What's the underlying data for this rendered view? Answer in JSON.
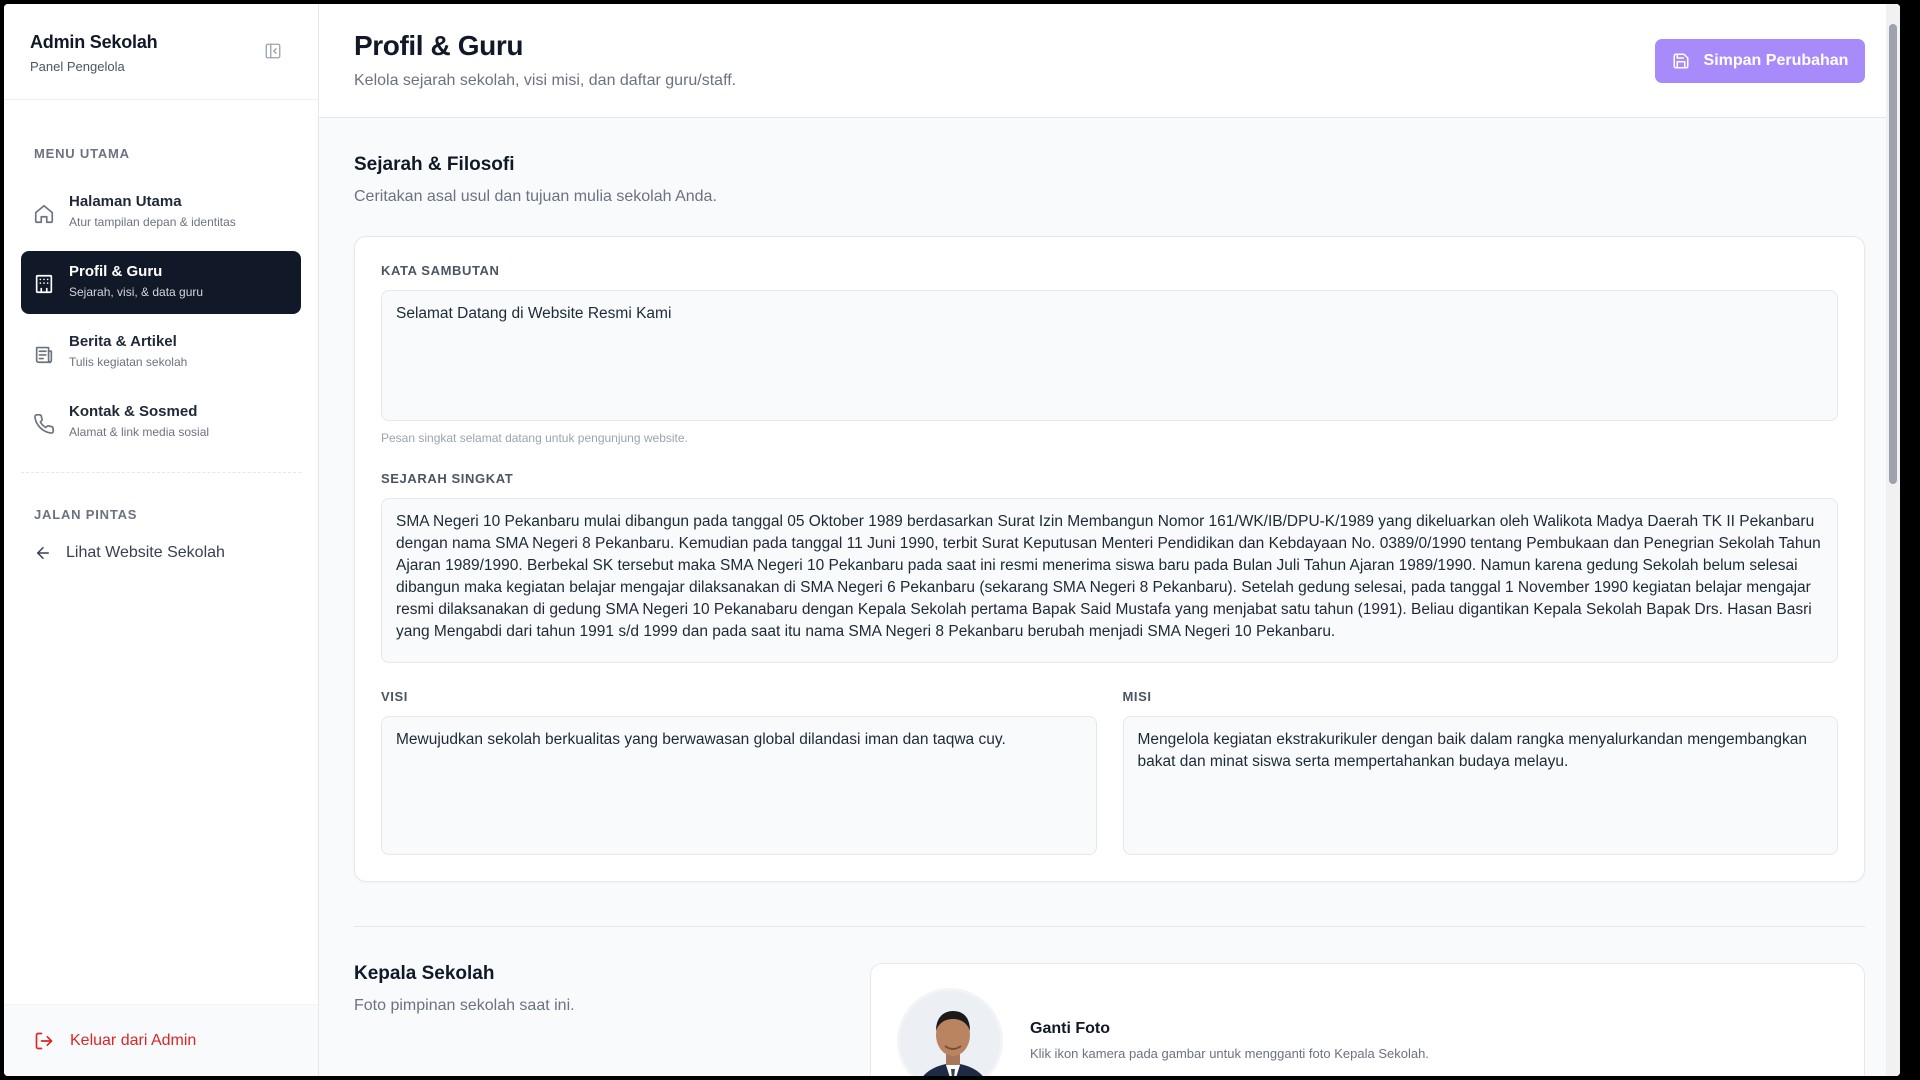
{
  "sidebar": {
    "brand_title": "Admin Sekolah",
    "brand_sub": "Panel Pengelola",
    "menu_label": "MENU UTAMA",
    "items": [
      {
        "title": "Halaman Utama",
        "sub": "Atur tampilan depan & identitas",
        "icon": "home-icon"
      },
      {
        "title": "Profil & Guru",
        "sub": "Sejarah, visi, & data guru",
        "icon": "building-icon",
        "active": true
      },
      {
        "title": "Berita & Artikel",
        "sub": "Tulis kegiatan sekolah",
        "icon": "newspaper-icon"
      },
      {
        "title": "Kontak & Sosmed",
        "sub": "Alamat & link media sosial",
        "icon": "phone-icon"
      }
    ],
    "shortcut_label": "JALAN PINTAS",
    "shortcut_link": "Lihat Website Sekolah",
    "logout": "Keluar dari Admin"
  },
  "header": {
    "title": "Profil & Guru",
    "subtitle": "Kelola sejarah sekolah, visi misi, dan daftar guru/staff.",
    "save_label": "Simpan Perubahan"
  },
  "sejarah": {
    "title": "Sejarah & Filosofi",
    "subtitle": "Ceritakan asal usul dan tujuan mulia sekolah Anda.",
    "kata_label": "KATA SAMBUTAN",
    "kata_value": "Selamat Datang di Website Resmi Kami",
    "kata_hint": "Pesan singkat selamat datang untuk pengunjung website.",
    "sejarah_label": "SEJARAH SINGKAT",
    "sejarah_value": "SMA Negeri 10 Pekanbaru mulai dibangun pada tanggal 05 Oktober 1989 berdasarkan Surat Izin Membangun Nomor 161/WK/IB/DPU-K/1989 yang dikeluarkan oleh Walikota Madya Daerah TK II Pekanbaru dengan nama SMA Negeri 8 Pekanbaru. Kemudian pada tanggal 11 Juni 1990, terbit Surat Keputusan Menteri Pendidikan dan Kebdayaan No. 0389/0/1990 tentang Pembukaan dan Penegrian Sekolah Tahun Ajaran 1989/1990. Berbekal SK tersebut maka SMA Negeri 10 Pekanbaru pada saat ini resmi menerima siswa baru pada Bulan Juli Tahun Ajaran 1989/1990. Namun karena gedung Sekolah belum selesai dibangun maka kegiatan belajar mengajar dilaksanakan di SMA Negeri 6 Pekanbaru (sekarang SMA Negeri 8 Pekanbaru). Setelah gedung selesai, pada tanggal 1 November 1990 kegiatan belajar mengajar resmi dilaksanakan di gedung SMA Negeri 10 Pekanabaru dengan Kepala Sekolah pertama Bapak Said Mustafa yang menjabat satu tahun (1991). Beliau digantikan Kepala Sekolah Bapak Drs. Hasan Basri yang Mengabdi dari tahun 1991 s/d 1999 dan pada saat itu nama SMA Negeri 8 Pekanbaru berubah menjadi SMA Negeri 10 Pekanbaru.",
    "visi_label": "VISI",
    "visi_value": "Mewujudkan sekolah berkualitas yang berwawasan global dilandasi iman dan taqwa cuy.",
    "misi_label": "MISI",
    "misi_value": "Mengelola kegiatan ekstrakurikuler dengan baik dalam rangka menyalurkandan mengembangkan bakat dan minat siswa serta mempertahankan budaya melayu."
  },
  "kepala": {
    "title": "Kepala Sekolah",
    "subtitle": "Foto pimpinan sekolah saat ini.",
    "ganti_title": "Ganti Foto",
    "ganti_sub": "Klik ikon kamera pada gambar untuk mengganti foto Kepala Sekolah."
  },
  "colors": {
    "accent": "#a78bfa",
    "active_nav": "#111827",
    "danger": "#dc2626"
  }
}
